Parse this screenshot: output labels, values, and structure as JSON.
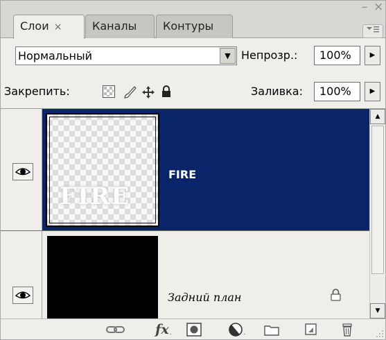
{
  "window": {
    "minimize_glyph": "–",
    "close_glyph": "×"
  },
  "tabs": [
    {
      "label": "Слои",
      "close": "×",
      "active": true
    },
    {
      "label": "Каналы",
      "active": false
    },
    {
      "label": "Контуры",
      "active": false
    }
  ],
  "controls": {
    "blend_mode": "Нормальный",
    "opacity_label": "Непрозр.:",
    "opacity_value": "100%",
    "lock_label": "Закрепить:",
    "fill_label": "Заливка:",
    "fill_value": "100%"
  },
  "layers": [
    {
      "name": "FIRE",
      "visible": true,
      "selected": true,
      "thumbnail_text": "FIRE"
    },
    {
      "name": "Задний план",
      "visible": true,
      "selected": false,
      "locked": true
    }
  ],
  "bottom_bar": {
    "fx_label": "fx"
  },
  "colors": {
    "selection": "#0a246a",
    "panel_bg": "#efeeeb"
  },
  "icons": [
    "link-icon",
    "fx-icon",
    "layer-mask-icon",
    "adjustment-layer-icon",
    "folder-icon",
    "new-layer-icon",
    "trash-icon",
    "eye-icon",
    "lock-icon"
  ]
}
